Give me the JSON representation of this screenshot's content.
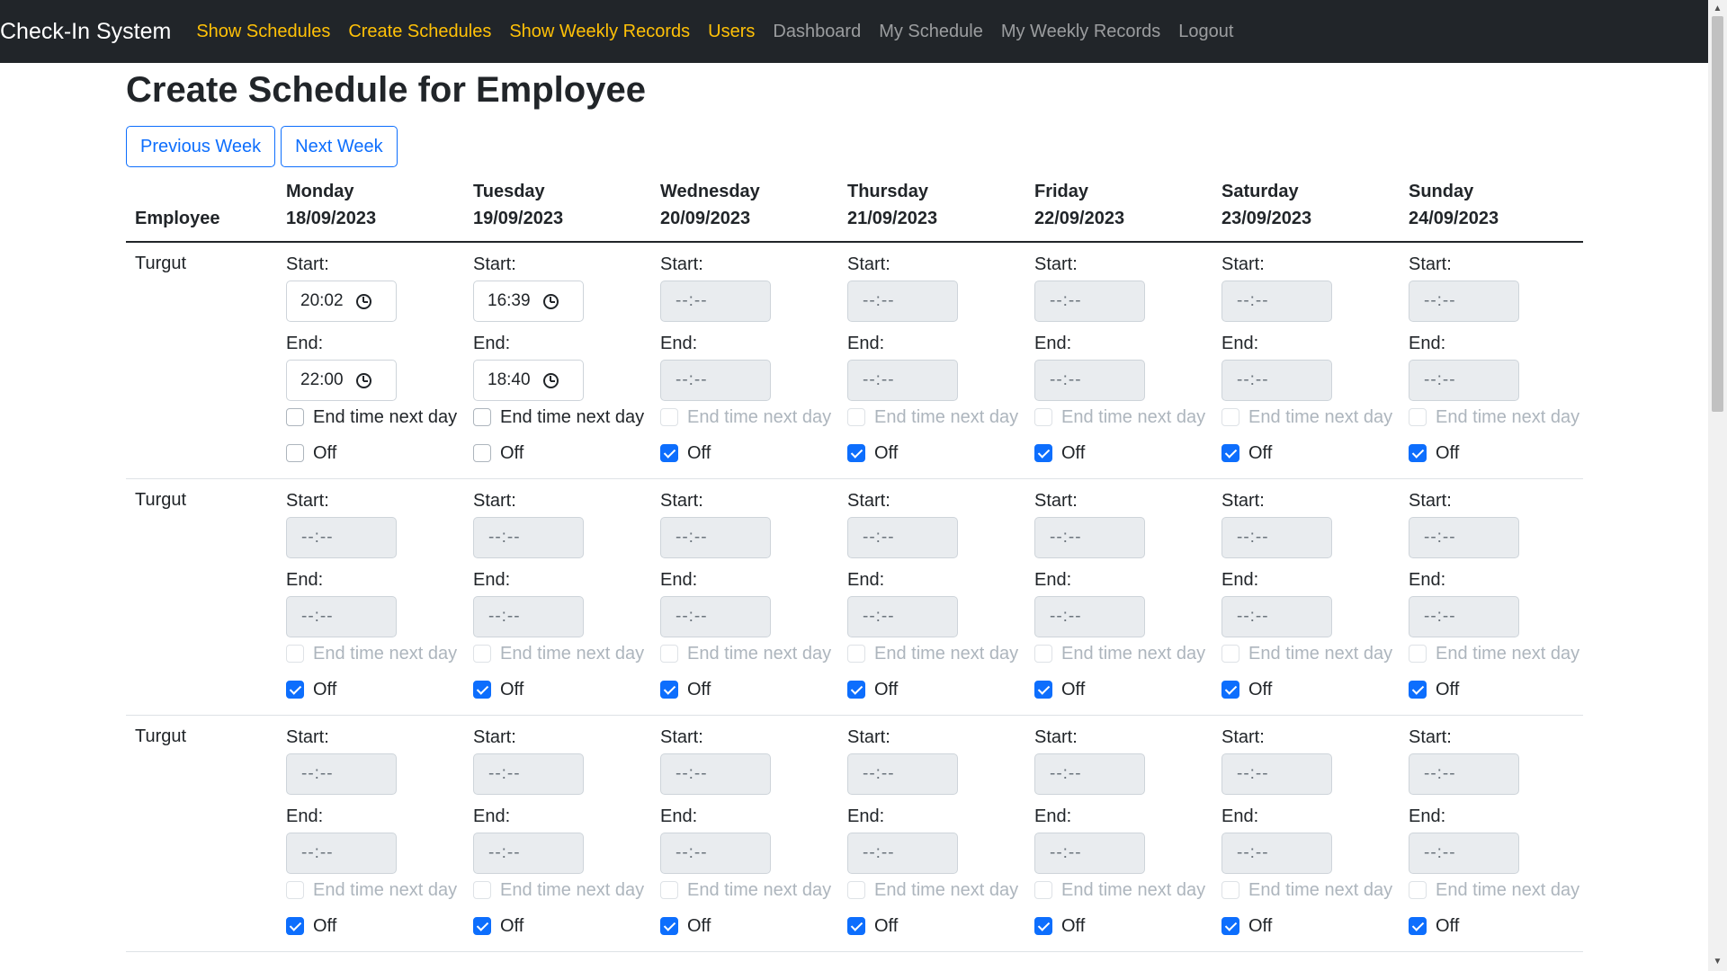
{
  "nav": {
    "brand": "Check-In System",
    "links": [
      {
        "label": "Show Schedules",
        "highlight": true
      },
      {
        "label": "Create Schedules",
        "highlight": true
      },
      {
        "label": "Show Weekly Records",
        "highlight": true
      },
      {
        "label": "Users",
        "highlight": true
      },
      {
        "label": "Dashboard",
        "highlight": false
      },
      {
        "label": "My Schedule",
        "highlight": false
      },
      {
        "label": "My Weekly Records",
        "highlight": false
      },
      {
        "label": "Logout",
        "highlight": false
      }
    ]
  },
  "page": {
    "title": "Create Schedule for Employee",
    "prev_week": "Previous Week",
    "next_week": "Next Week"
  },
  "table": {
    "employee_header": "Employee",
    "days": [
      {
        "name": "Monday",
        "date": "18/09/2023"
      },
      {
        "name": "Tuesday",
        "date": "19/09/2023"
      },
      {
        "name": "Wednesday",
        "date": "20/09/2023"
      },
      {
        "name": "Thursday",
        "date": "21/09/2023"
      },
      {
        "name": "Friday",
        "date": "22/09/2023"
      },
      {
        "name": "Saturday",
        "date": "23/09/2023"
      },
      {
        "name": "Sunday",
        "date": "24/09/2023"
      }
    ],
    "start_label": "Start:",
    "end_label": "End:",
    "next_day_label": "End time next day",
    "off_label": "Off",
    "empty_time": "--:--",
    "rows": [
      {
        "employee": "Turgut",
        "cells": [
          {
            "start": "20:02",
            "end": "22:00",
            "next_day": false,
            "off": false
          },
          {
            "start": "16:39",
            "end": "18:40",
            "next_day": false,
            "off": false
          },
          {
            "start": "",
            "end": "",
            "next_day": false,
            "off": true
          },
          {
            "start": "",
            "end": "",
            "next_day": false,
            "off": true
          },
          {
            "start": "",
            "end": "",
            "next_day": false,
            "off": true
          },
          {
            "start": "",
            "end": "",
            "next_day": false,
            "off": true
          },
          {
            "start": "",
            "end": "",
            "next_day": false,
            "off": true
          }
        ]
      },
      {
        "employee": "Turgut",
        "cells": [
          {
            "start": "",
            "end": "",
            "next_day": false,
            "off": true
          },
          {
            "start": "",
            "end": "",
            "next_day": false,
            "off": true
          },
          {
            "start": "",
            "end": "",
            "next_day": false,
            "off": true
          },
          {
            "start": "",
            "end": "",
            "next_day": false,
            "off": true
          },
          {
            "start": "",
            "end": "",
            "next_day": false,
            "off": true
          },
          {
            "start": "",
            "end": "",
            "next_day": false,
            "off": true
          },
          {
            "start": "",
            "end": "",
            "next_day": false,
            "off": true
          }
        ]
      },
      {
        "employee": "Turgut",
        "cells": [
          {
            "start": "",
            "end": "",
            "next_day": false,
            "off": true
          },
          {
            "start": "",
            "end": "",
            "next_day": false,
            "off": true
          },
          {
            "start": "",
            "end": "",
            "next_day": false,
            "off": true
          },
          {
            "start": "",
            "end": "",
            "next_day": false,
            "off": true
          },
          {
            "start": "",
            "end": "",
            "next_day": false,
            "off": true
          },
          {
            "start": "",
            "end": "",
            "next_day": false,
            "off": true
          },
          {
            "start": "",
            "end": "",
            "next_day": false,
            "off": true
          }
        ]
      }
    ]
  },
  "colors": {
    "navbar_bg": "#212529",
    "nav_highlight": "#ffc107",
    "primary": "#0d6efd",
    "disabled_input_bg": "#e9ecef"
  }
}
